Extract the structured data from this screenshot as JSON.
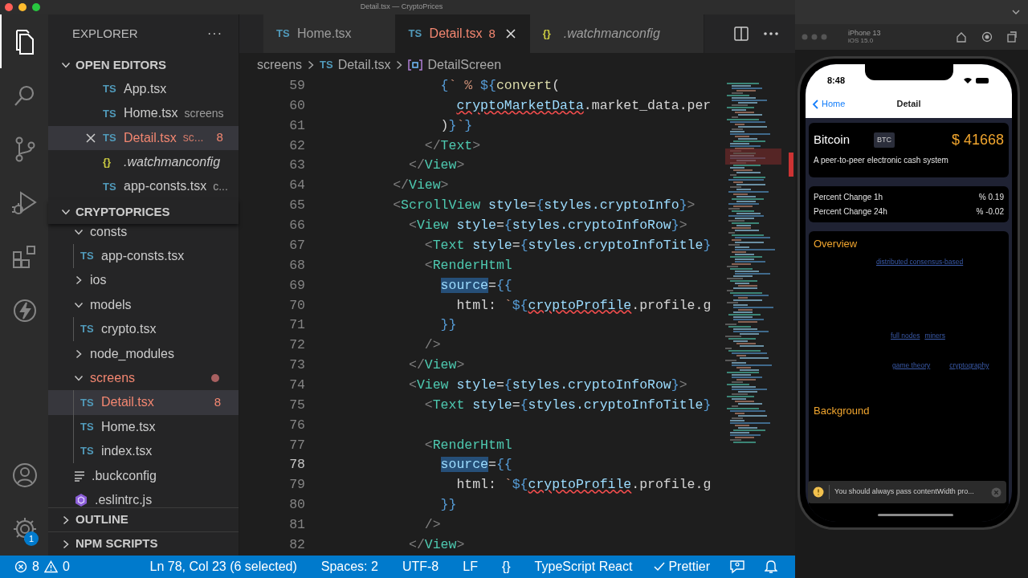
{
  "window": {
    "title": "Detail.tsx — CryptoPrices"
  },
  "activity_bar": [
    {
      "kind": "files",
      "selected": true
    },
    {
      "kind": "search",
      "selected": false
    },
    {
      "kind": "source-control",
      "selected": false
    },
    {
      "kind": "run",
      "selected": false
    },
    {
      "kind": "extensions",
      "selected": false
    },
    {
      "kind": "bolt",
      "selected": false
    },
    {
      "kind": "account",
      "selected": false
    },
    {
      "kind": "settings",
      "selected": false,
      "badge": "1"
    }
  ],
  "sidebar": {
    "title": "EXPLORER",
    "more": "···",
    "open_editors": {
      "title": "OPEN EDITORS",
      "expanded": true,
      "items": [
        {
          "label": "App.tsx",
          "kind": "ts",
          "icon": "TS",
          "selected": false,
          "error": false
        },
        {
          "label": "Home.tsx",
          "kind": "ts",
          "icon": "TS",
          "description": "screens",
          "selected": false,
          "error": false
        },
        {
          "label": "Detail.tsx",
          "kind": "ts",
          "icon": "TS",
          "description": "sc...",
          "badge": "8",
          "selected": true,
          "error": true
        },
        {
          "label": ".watchmanconfig",
          "kind": "json",
          "icon": "{}",
          "selected": false,
          "error": false
        },
        {
          "label": "app-consts.tsx",
          "kind": "ts",
          "icon": "TS",
          "description": "c...",
          "selected": false,
          "error": false
        }
      ]
    },
    "project": {
      "title": "CRYPTOPRICES",
      "expanded": true,
      "tree": [
        {
          "label": "consts",
          "kind": "folder",
          "expanded": true,
          "selected": false,
          "error": false,
          "children": [
            {
              "label": "app-consts.tsx",
              "kind": "ts",
              "icon": "TS",
              "selected": false,
              "error": false
            }
          ]
        },
        {
          "label": "ios",
          "kind": "folder",
          "expanded": false,
          "selected": false,
          "error": false
        },
        {
          "label": "models",
          "kind": "folder",
          "expanded": true,
          "selected": false,
          "error": false,
          "children": [
            {
              "label": "crypto.tsx",
              "kind": "ts",
              "icon": "TS",
              "selected": false,
              "error": false
            }
          ]
        },
        {
          "label": "node_modules",
          "kind": "folder",
          "expanded": false,
          "selected": false,
          "error": false
        },
        {
          "label": "screens",
          "kind": "folder",
          "expanded": true,
          "selected": false,
          "error": true,
          "dot": true,
          "children": [
            {
              "label": "Detail.tsx",
              "kind": "ts",
              "icon": "TS",
              "badge": "8",
              "selected": true,
              "error": true
            },
            {
              "label": "Home.tsx",
              "kind": "ts",
              "icon": "TS",
              "selected": false,
              "error": false
            },
            {
              "label": "index.tsx",
              "kind": "ts",
              "icon": "TS",
              "selected": false,
              "error": false
            }
          ]
        },
        {
          "label": ".buckconfig",
          "kind": "config",
          "selected": false,
          "error": false
        },
        {
          "label": ".eslintrc.js",
          "kind": "eslint",
          "selected": false,
          "error": false
        }
      ]
    },
    "sections": [
      {
        "title": "OUTLINE",
        "expanded": false
      },
      {
        "title": "NPM SCRIPTS",
        "expanded": false
      }
    ]
  },
  "tabs": [
    {
      "label": "Home.tsx",
      "kind": "ts",
      "icon": "TS",
      "selected": false,
      "error": false,
      "italic": false
    },
    {
      "label": "Detail.tsx",
      "kind": "ts",
      "icon": "TS",
      "badge": "8",
      "selected": true,
      "error": true,
      "italic": false
    },
    {
      "label": ".watchmanconfig",
      "kind": "json",
      "icon": "{}",
      "selected": false,
      "error": false,
      "italic": true
    }
  ],
  "breadcrumb": {
    "folder": "screens",
    "file_icon": "TS",
    "file": "Detail.tsx",
    "symbol": "DetailScreen"
  },
  "code": [
    {
      "number": "59",
      "current": false,
      "tokens": [
        {
          "text": "{",
          "kind": "brace"
        },
        {
          "text": "` % ",
          "kind": "string"
        },
        {
          "text": "${",
          "kind": "brace"
        },
        {
          "text": "convert",
          "kind": "function"
        },
        {
          "text": "(",
          "kind": "plain"
        }
      ]
    },
    {
      "number": "60",
      "current": false,
      "tokens": [
        {
          "text": "cryptoMarketData",
          "kind": "var-error"
        },
        {
          "text": ".market_data.per",
          "kind": "plain"
        }
      ]
    },
    {
      "number": "61",
      "current": false,
      "tokens": [
        {
          "text": ")",
          "kind": "plain"
        },
        {
          "text": "}",
          "kind": "brace"
        },
        {
          "text": "`",
          "kind": "string"
        },
        {
          "text": "}",
          "kind": "brace"
        }
      ]
    },
    {
      "number": "62",
      "current": false,
      "tokens": [
        {
          "text": "</",
          "kind": "punct"
        },
        {
          "text": "Text",
          "kind": "tag"
        },
        {
          "text": ">",
          "kind": "punct"
        }
      ]
    },
    {
      "number": "63",
      "current": false,
      "tokens": [
        {
          "text": "</",
          "kind": "punct"
        },
        {
          "text": "View",
          "kind": "tag"
        },
        {
          "text": ">",
          "kind": "punct"
        }
      ]
    },
    {
      "number": "64",
      "current": false,
      "tokens": [
        {
          "text": "</",
          "kind": "punct"
        },
        {
          "text": "View",
          "kind": "tag"
        },
        {
          "text": ">",
          "kind": "punct"
        }
      ]
    },
    {
      "number": "65",
      "current": false,
      "tokens": [
        {
          "text": "<",
          "kind": "punct"
        },
        {
          "text": "ScrollView",
          "kind": "tag"
        },
        {
          "text": "style",
          "kind": "attr"
        },
        {
          "text": "=",
          "kind": "plain"
        },
        {
          "text": "{",
          "kind": "brace"
        },
        {
          "text": "styles.cryptoInfo",
          "kind": "var"
        },
        {
          "text": "}",
          "kind": "brace"
        },
        {
          "text": ">",
          "kind": "punct"
        }
      ]
    },
    {
      "number": "66",
      "current": false,
      "tokens": [
        {
          "text": "<",
          "kind": "punct"
        },
        {
          "text": "View",
          "kind": "tag"
        },
        {
          "text": "style",
          "kind": "attr"
        },
        {
          "text": "=",
          "kind": "plain"
        },
        {
          "text": "{",
          "kind": "brace"
        },
        {
          "text": "styles.cryptoInfoRow",
          "kind": "var"
        },
        {
          "text": "}",
          "kind": "brace"
        },
        {
          "text": ">",
          "kind": "punct"
        }
      ]
    },
    {
      "number": "67",
      "current": false,
      "tokens": [
        {
          "text": "<",
          "kind": "punct"
        },
        {
          "text": "Text",
          "kind": "tag"
        },
        {
          "text": "style",
          "kind": "attr"
        },
        {
          "text": "=",
          "kind": "plain"
        },
        {
          "text": "{",
          "kind": "brace"
        },
        {
          "text": "styles.cryptoInfoTitle",
          "kind": "var"
        },
        {
          "text": "}",
          "kind": "brace"
        }
      ]
    },
    {
      "number": "68",
      "current": false,
      "tokens": [
        {
          "text": "<",
          "kind": "punct"
        },
        {
          "text": "RenderHtml",
          "kind": "tag"
        }
      ]
    },
    {
      "number": "69",
      "current": false,
      "tokens": [
        {
          "text": "source",
          "kind": "attr-selected"
        },
        {
          "text": "=",
          "kind": "plain"
        },
        {
          "text": "{{",
          "kind": "brace"
        }
      ]
    },
    {
      "number": "70",
      "current": false,
      "tokens": [
        {
          "text": "html: ",
          "kind": "plain"
        },
        {
          "text": "`",
          "kind": "string"
        },
        {
          "text": "${",
          "kind": "brace"
        },
        {
          "text": "cryptoProfile",
          "kind": "var-error"
        },
        {
          "text": ".profile.g",
          "kind": "plain"
        }
      ]
    },
    {
      "number": "71",
      "current": false,
      "tokens": [
        {
          "text": "}}",
          "kind": "brace"
        }
      ]
    },
    {
      "number": "72",
      "current": false,
      "tokens": [
        {
          "text": "/>",
          "kind": "punct"
        }
      ]
    },
    {
      "number": "73",
      "current": false,
      "tokens": [
        {
          "text": "</",
          "kind": "punct"
        },
        {
          "text": "View",
          "kind": "tag"
        },
        {
          "text": ">",
          "kind": "punct"
        }
      ]
    },
    {
      "number": "74",
      "current": false,
      "tokens": [
        {
          "text": "<",
          "kind": "punct"
        },
        {
          "text": "View",
          "kind": "tag"
        },
        {
          "text": "style",
          "kind": "attr"
        },
        {
          "text": "=",
          "kind": "plain"
        },
        {
          "text": "{",
          "kind": "brace"
        },
        {
          "text": "styles.cryptoInfoRow",
          "kind": "var"
        },
        {
          "text": "}",
          "kind": "brace"
        },
        {
          "text": ">",
          "kind": "punct"
        }
      ]
    },
    {
      "number": "75",
      "current": false,
      "tokens": [
        {
          "text": "<",
          "kind": "punct"
        },
        {
          "text": "Text",
          "kind": "tag"
        },
        {
          "text": "style",
          "kind": "attr"
        },
        {
          "text": "=",
          "kind": "plain"
        },
        {
          "text": "{",
          "kind": "brace"
        },
        {
          "text": "styles.cryptoInfoTitle",
          "kind": "var"
        },
        {
          "text": "}",
          "kind": "brace"
        }
      ]
    },
    {
      "number": "76",
      "current": false
    },
    {
      "number": "77",
      "current": false,
      "tokens": [
        {
          "text": "<",
          "kind": "punct"
        },
        {
          "text": "RenderHtml",
          "kind": "tag"
        }
      ]
    },
    {
      "number": "78",
      "current": true,
      "tokens": [
        {
          "text": "source",
          "kind": "attr-selected"
        },
        {
          "text": "=",
          "kind": "plain"
        },
        {
          "text": "{{",
          "kind": "brace"
        }
      ]
    },
    {
      "number": "79",
      "current": false,
      "tokens": [
        {
          "text": "html: ",
          "kind": "plain"
        },
        {
          "text": "`",
          "kind": "string"
        },
        {
          "text": "${",
          "kind": "brace"
        },
        {
          "text": "cryptoProfile",
          "kind": "var-error"
        },
        {
          "text": ".profile.g",
          "kind": "plain"
        }
      ]
    },
    {
      "number": "80",
      "current": false,
      "tokens": [
        {
          "text": "}}",
          "kind": "brace"
        }
      ]
    },
    {
      "number": "81",
      "current": false,
      "tokens": [
        {
          "text": "/>",
          "kind": "punct"
        }
      ]
    },
    {
      "number": "82",
      "current": false,
      "tokens": [
        {
          "text": "</",
          "kind": "punct"
        },
        {
          "text": "View",
          "kind": "tag"
        },
        {
          "text": ">",
          "kind": "punct"
        }
      ]
    }
  ],
  "status_bar": {
    "errors": "8",
    "warnings": "0",
    "items": [
      {
        "kind": "text",
        "label": "Ln 78, Col 23 (6 selected)"
      },
      {
        "kind": "text",
        "label": "Spaces: 2"
      },
      {
        "kind": "text",
        "label": "UTF-8"
      },
      {
        "kind": "text",
        "label": "LF"
      },
      {
        "kind": "text",
        "label": "{}"
      },
      {
        "kind": "text",
        "label": "TypeScript React"
      },
      {
        "kind": "check",
        "label": "Prettier"
      },
      {
        "kind": "feedback"
      },
      {
        "kind": "bell"
      }
    ]
  },
  "simulator": {
    "device": "iPhone 13",
    "os": "iOS 15.0",
    "app": {
      "time": "8:48",
      "back": "Home",
      "title": "Detail",
      "coin": {
        "name": "Bitcoin",
        "symbol": "BTC",
        "price": "$ 41668",
        "description": "A peer-to-peer electronic cash system"
      },
      "changes": [
        {
          "label": "Percent Change 1h",
          "value": "% 0.19"
        },
        {
          "label": "Percent Change 24h",
          "value": "% -0.02"
        }
      ],
      "sections": [
        {
          "title": "Overview",
          "link_rows": [
            [
              "distributed consensus-based"
            ],
            [
              "full nodes",
              "miners"
            ],
            [
              "game theory",
              "cryptography"
            ]
          ]
        },
        {
          "title": "Background"
        }
      ],
      "toast": {
        "text": "You should always pass contentWidth pro..."
      }
    }
  }
}
